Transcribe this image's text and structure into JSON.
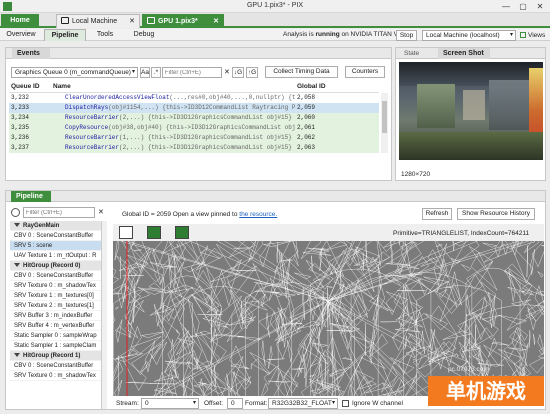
{
  "window": {
    "title": "GPU 1.pix3* - PIX",
    "controls": [
      "—",
      "▢",
      "✕"
    ]
  },
  "doc_tabs": {
    "home": "Home",
    "tabs": [
      {
        "label": "Local Machine",
        "close": "✕"
      },
      {
        "label": "GPU 1.pix3*",
        "close": "✕"
      }
    ]
  },
  "subnav": {
    "tabs": [
      "Overview",
      "Pipeline",
      "Tools",
      "Debug"
    ],
    "status_prefix": "Analysis is ",
    "status_bold": "running",
    "status_suffix": " on NVIDIA TITAN V.",
    "stop": "Stop",
    "machine": "Local Machine (localhost)",
    "views": "Views"
  },
  "events": {
    "title": "Events",
    "queue": "Graphics Queue 0 (m_commandQueue)",
    "case_btn": "Aa",
    "regex_btn": ".*",
    "filter_placeholder": "Filter (Ctrl+E)",
    "clear": "✕",
    "next_btn": "G",
    "prev_btn": "G",
    "timing_btn": "Collect Timing Data",
    "counters_btn": "Counters",
    "columns": [
      "Queue ID",
      "Name",
      "Global ID"
    ],
    "rows": [
      {
        "qid": "3,232",
        "name": "ClearUnorderedAccessViewFloat",
        "args": "(...,res#0,obj#40,...,0,nullptr)  {t",
        "gid": "2,058"
      },
      {
        "qid": "3,233",
        "name": "DispatchRays",
        "args": "(obj#1154,...)  {this->ID3D12CommandList Raytracing Pro",
        "gid": "2,059"
      },
      {
        "qid": "3,234",
        "name": "ResourceBarrier",
        "args": "(2,...)  {this->ID3D12GraphicsCommandList obj#15}",
        "gid": "2,060"
      },
      {
        "qid": "3,235",
        "name": "CopyResource",
        "args": "(obj#38,obj#40)  {this->ID3D12GraphicsCommandList obj",
        "gid": "2,061"
      },
      {
        "qid": "3,236",
        "name": "ResourceBarrier",
        "args": "(1,...)  {this->ID3D12GraphicsCommandList obj#15}",
        "gid": "2,062"
      },
      {
        "qid": "3,237",
        "name": "ResourceBarrier",
        "args": "(2,...)  {this->ID3D12GraphicsCommandList obj#15}",
        "gid": "2,063"
      }
    ]
  },
  "screenshot": {
    "tabs": [
      "State",
      "Screen Shot"
    ],
    "resolution": "1280×720"
  },
  "pipeline": {
    "title": "Pipeline",
    "filter_placeholder": "Filter (Ctrl+E)",
    "global_id_text": "Global ID = 2059   Open a view pinned to ",
    "resource_link": "the resource.",
    "refresh": "Refresh",
    "show_history": "Show Resource History",
    "topology": "Primitive=TRIANGLELIST, IndexCount=764211",
    "list": [
      {
        "label": "RayGenMain",
        "type": "group"
      },
      {
        "label": "CBV 0 : SceneConstantBuffer",
        "type": "item"
      },
      {
        "label": "SRV 5 : scene",
        "type": "selected"
      },
      {
        "label": "UAV Texture 1 : m_rtOutput : R",
        "type": "item"
      },
      {
        "label": "HitGroup (Record 0)",
        "type": "group"
      },
      {
        "label": "CBV 0 : SceneConstantBuffer",
        "type": "item"
      },
      {
        "label": "SRV Texture 0 : m_shadowTex",
        "type": "item"
      },
      {
        "label": "SRV Texture 1 : m_textures[0]",
        "type": "item"
      },
      {
        "label": "SRV Texture 2 : m_textures[1]",
        "type": "item"
      },
      {
        "label": "SRV Buffer 3 : m_indexBuffer",
        "type": "item"
      },
      {
        "label": "SRV Buffer 4 : m_vertexBuffer",
        "type": "item"
      },
      {
        "label": "Static Sampler 0 : sampleWrap",
        "type": "item"
      },
      {
        "label": "Static Sampler 1 : sampleClam",
        "type": "item"
      },
      {
        "label": "HitGroup (Record 1)",
        "type": "group"
      },
      {
        "label": "CBV 0 : SceneConstantBuffer",
        "type": "item"
      },
      {
        "label": "SRV Texture 0 : m_shadowTex",
        "type": "item"
      }
    ],
    "stream_label": "Stream:",
    "stream_value": "0",
    "offset_label": "Offset:",
    "offset_value": "0",
    "format_label": "Format:",
    "format_value": "R32G32B32_FLOAT",
    "ignore_w": "Ignore W channel"
  },
  "watermark": {
    "url": "pc.07073.com",
    "brand": "单机游戏"
  },
  "colors": {
    "accent": "#3e8e3e",
    "selection": "#cfe3f3",
    "viewport": "#777777"
  }
}
